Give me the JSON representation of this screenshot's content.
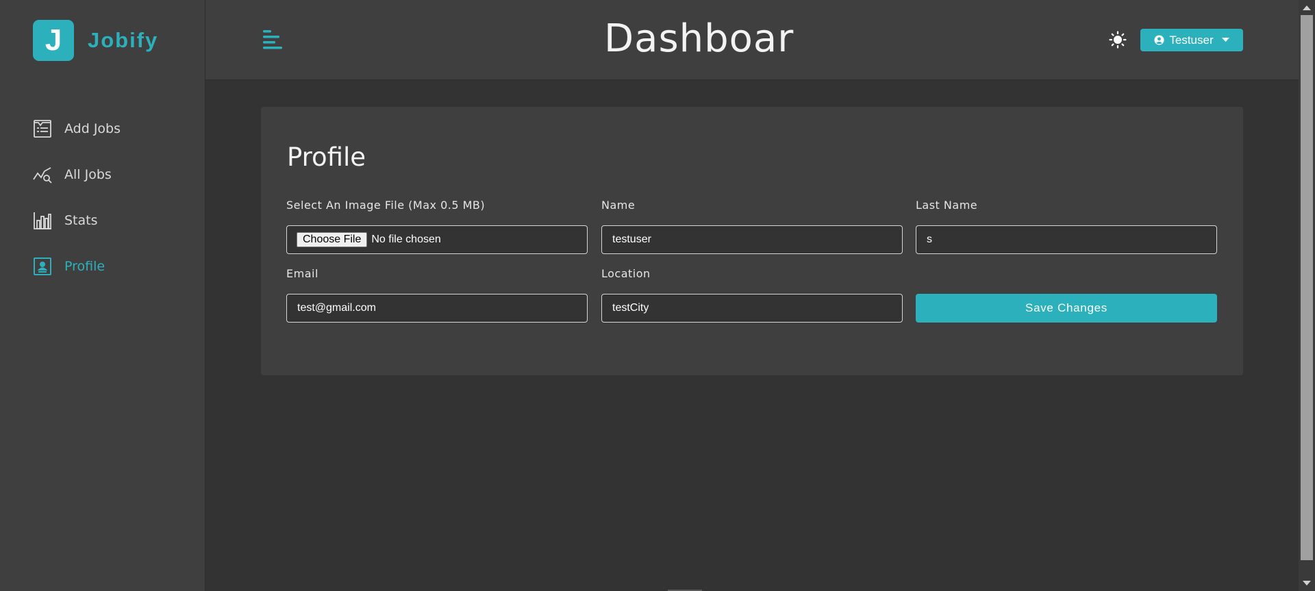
{
  "brand": {
    "logo_letter": "J",
    "name": "Jobify",
    "accent_color": "#2cb1bc"
  },
  "sidebar": {
    "items": [
      {
        "label": "Add Jobs",
        "icon": "add-jobs-icon",
        "active": false
      },
      {
        "label": "All Jobs",
        "icon": "all-jobs-icon",
        "active": false
      },
      {
        "label": "Stats",
        "icon": "stats-icon",
        "active": false
      },
      {
        "label": "Profile",
        "icon": "profile-icon",
        "active": true
      }
    ]
  },
  "header": {
    "title": "Dashboar",
    "theme_icon": "sun-icon",
    "user_label": "Testuser"
  },
  "profile": {
    "title": "Profile",
    "image": {
      "label": "Select An Image File (Max 0.5 MB)",
      "button": "Choose File",
      "status": "No file chosen"
    },
    "name": {
      "label": "Name",
      "value": "testuser"
    },
    "last_name": {
      "label": "Last Name",
      "value": "s"
    },
    "email": {
      "label": "Email",
      "value": "test@gmail.com"
    },
    "location": {
      "label": "Location",
      "value": "testCity"
    },
    "save_label": "Save Changes"
  }
}
